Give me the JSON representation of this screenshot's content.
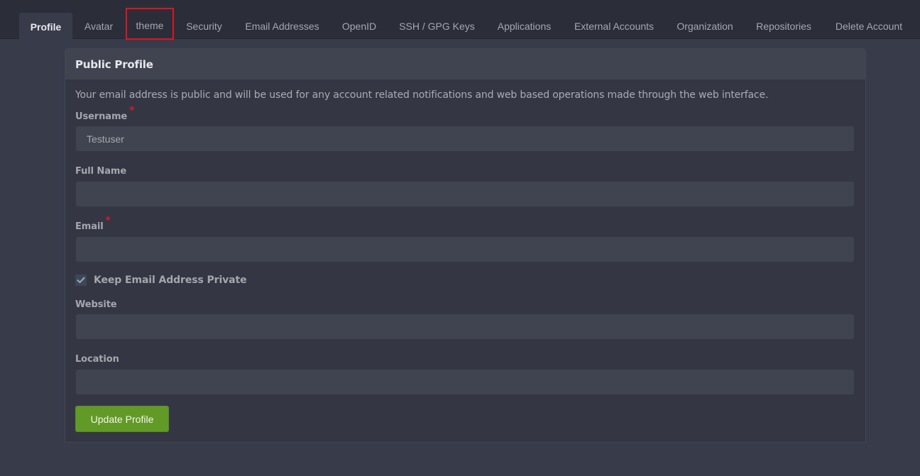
{
  "tabs": [
    {
      "label": "Profile",
      "active": true
    },
    {
      "label": "Avatar"
    },
    {
      "label": "theme",
      "highlighted": true
    },
    {
      "label": "Security"
    },
    {
      "label": "Email Addresses"
    },
    {
      "label": "OpenID"
    },
    {
      "label": "SSH / GPG Keys"
    },
    {
      "label": "Applications"
    },
    {
      "label": "External Accounts"
    },
    {
      "label": "Organization"
    },
    {
      "label": "Repositories"
    },
    {
      "label": "Delete Account"
    }
  ],
  "panel": {
    "title": "Public Profile",
    "notice": "Your email address is public and will be used for any account related notifications and web based operations made through the web interface.",
    "required_mark": "*",
    "fields": {
      "username": {
        "label": "Username",
        "value": "Testuser",
        "required": true
      },
      "full_name": {
        "label": "Full Name",
        "value": ""
      },
      "email": {
        "label": "Email",
        "value": "",
        "required": true
      },
      "website": {
        "label": "Website",
        "value": ""
      },
      "location": {
        "label": "Location",
        "value": ""
      }
    },
    "keep_email_private": {
      "label": "Keep Email Address Private",
      "checked": true
    },
    "submit_label": "Update Profile"
  },
  "colors": {
    "highlight_outline": "#e0141e",
    "submit_button": "#629a28",
    "required": "#d21b2a"
  }
}
